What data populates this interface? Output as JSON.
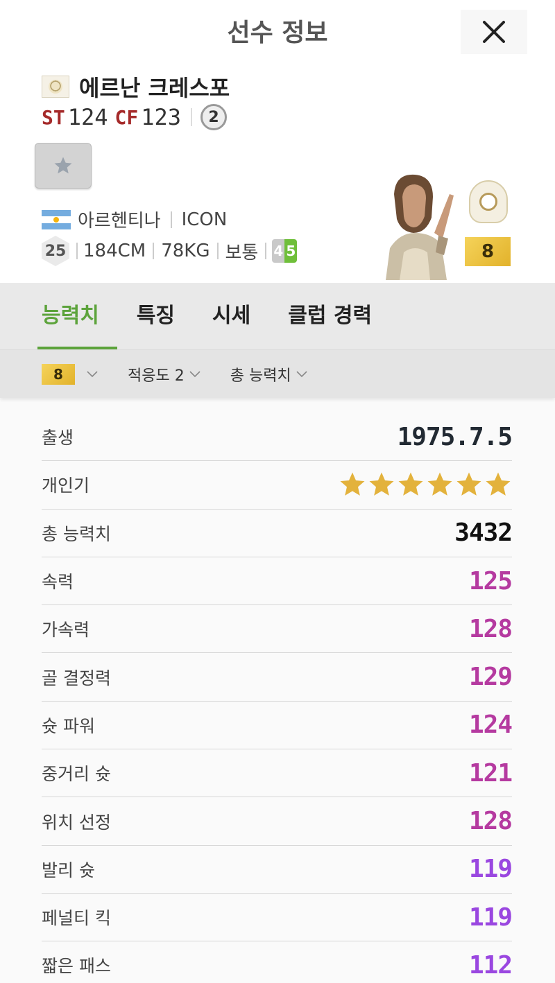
{
  "header": {
    "title": "선수 정보"
  },
  "player": {
    "name": "에르난 크레스포",
    "positions": [
      {
        "name": "ST",
        "value": "124"
      },
      {
        "name": "CF",
        "value": "123"
      }
    ],
    "trade_count": "2",
    "nation": "아르헨티나",
    "season": "ICON",
    "age": "25",
    "height": "184CM",
    "weight": "78KG",
    "body_type": "보통",
    "weak_foot": "4",
    "strong_foot": "5",
    "grade": "8"
  },
  "tabs": [
    {
      "label": "능력치",
      "active": true
    },
    {
      "label": "특징",
      "active": false
    },
    {
      "label": "시세",
      "active": false
    },
    {
      "label": "클럽 경력",
      "active": false
    }
  ],
  "filters": {
    "grade": "8",
    "adaptability": "적응도 2",
    "ovr": "총 능력치"
  },
  "stats": [
    {
      "label": "출생",
      "value": "1975.7.5",
      "color": "#222a33"
    },
    {
      "label": "개인기",
      "stars": 6,
      "color": "#e3b23c"
    },
    {
      "label": "총 능력치",
      "value": "3432",
      "color": "#111111"
    },
    {
      "label": "속력",
      "value": "125",
      "color": "#b53aa0"
    },
    {
      "label": "가속력",
      "value": "128",
      "color": "#b53aa0"
    },
    {
      "label": "골 결정력",
      "value": "129",
      "color": "#b53aa0"
    },
    {
      "label": "슛 파워",
      "value": "124",
      "color": "#b53aa0"
    },
    {
      "label": "중거리 슛",
      "value": "121",
      "color": "#b53aa0"
    },
    {
      "label": "위치 선정",
      "value": "128",
      "color": "#b53aa0"
    },
    {
      "label": "발리 슛",
      "value": "119",
      "color": "#9a47e0"
    },
    {
      "label": "페널티 킥",
      "value": "119",
      "color": "#9a47e0"
    },
    {
      "label": "짧은 패스",
      "value": "112",
      "color": "#9a47e0"
    }
  ],
  "colors": {
    "accent": "#5ca33b",
    "position": "#a52a2a"
  },
  "icons": [
    "close-icon",
    "star-icon",
    "chevron-down-icon"
  ]
}
